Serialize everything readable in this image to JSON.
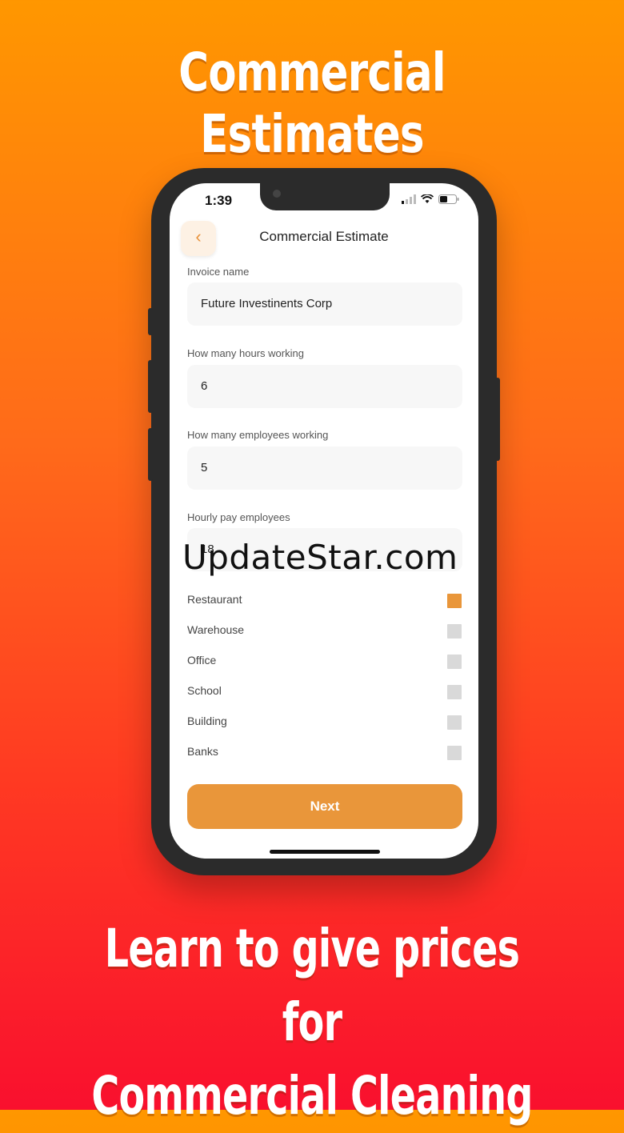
{
  "promo": {
    "headline": "Commercial Estimates",
    "tagline_line1": "Learn to give prices for",
    "tagline_line2": "Commercial Cleaning"
  },
  "status_bar": {
    "time": "1:39"
  },
  "header": {
    "back_icon": "chevron-left-icon",
    "title": "Commercial Estimate"
  },
  "form": {
    "invoice_name": {
      "label": "Invoice name",
      "value": "Future Investinents Corp"
    },
    "hours": {
      "label": "How many hours working",
      "value": "6"
    },
    "employees": {
      "label": "How many employees working",
      "value": "5"
    },
    "hourly_pay": {
      "label": "Hourly pay employees",
      "value": "18"
    }
  },
  "options": [
    {
      "label": "Restaurant",
      "checked": true
    },
    {
      "label": "Warehouse",
      "checked": false
    },
    {
      "label": "Office",
      "checked": false
    },
    {
      "label": "School",
      "checked": false
    },
    {
      "label": "Building",
      "checked": false
    },
    {
      "label": "Banks",
      "checked": false
    }
  ],
  "next_button": "Next",
  "watermark": "UpdateStar.com",
  "colors": {
    "accent": "#e9963a",
    "bg_top": "#ff9700",
    "bg_bottom": "#f9102e"
  }
}
